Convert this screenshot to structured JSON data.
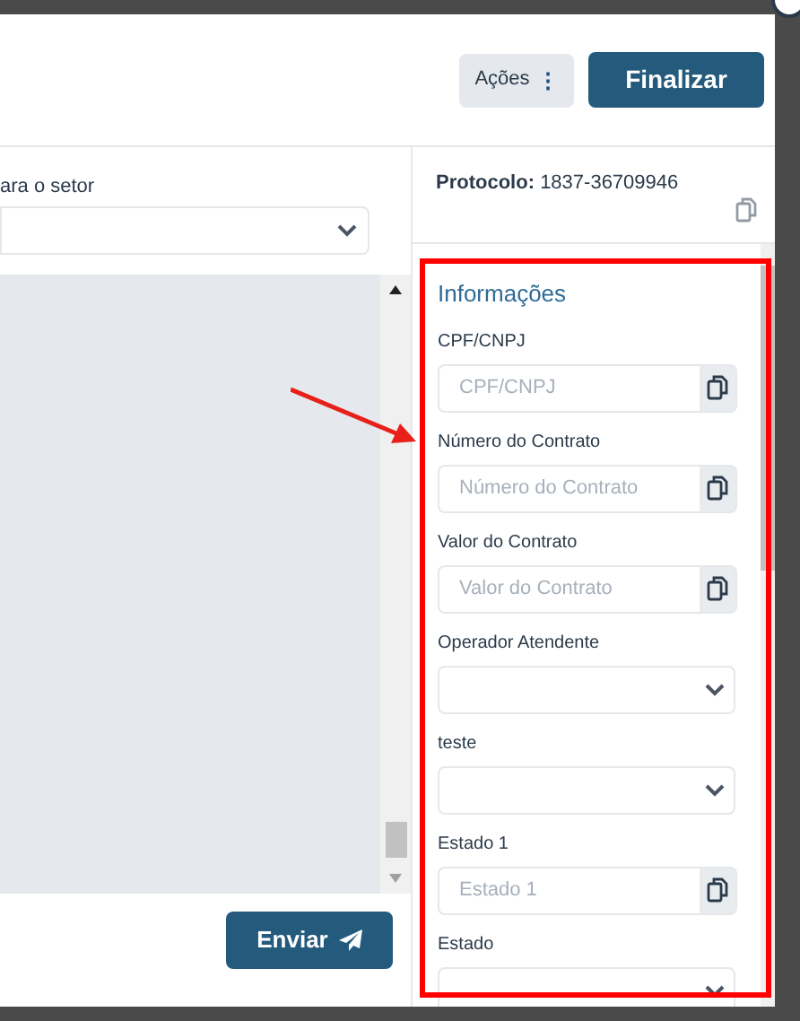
{
  "header": {
    "actions_button": "Ações",
    "actions_icon": "⋮",
    "finish_button": "Finalizar"
  },
  "left_pane": {
    "sector_label": "ara o setor",
    "send_button": "Enviar"
  },
  "protocol": {
    "label": "Protocolo:",
    "value": "1837-36709946"
  },
  "info": {
    "title": "Informações",
    "fields": [
      {
        "kind": "text",
        "label": "CPF/CNPJ",
        "placeholder": "CPF/CNPJ"
      },
      {
        "kind": "text",
        "label": "Número do Contrato",
        "placeholder": "Número do Contrato"
      },
      {
        "kind": "text",
        "label": "Valor do Contrato",
        "placeholder": "Valor do Contrato"
      },
      {
        "kind": "select",
        "label": "Operador Atendente"
      },
      {
        "kind": "select",
        "label": "teste"
      },
      {
        "kind": "text",
        "label": "Estado 1",
        "placeholder": "Estado 1"
      },
      {
        "kind": "select",
        "label": "Estado"
      }
    ]
  }
}
